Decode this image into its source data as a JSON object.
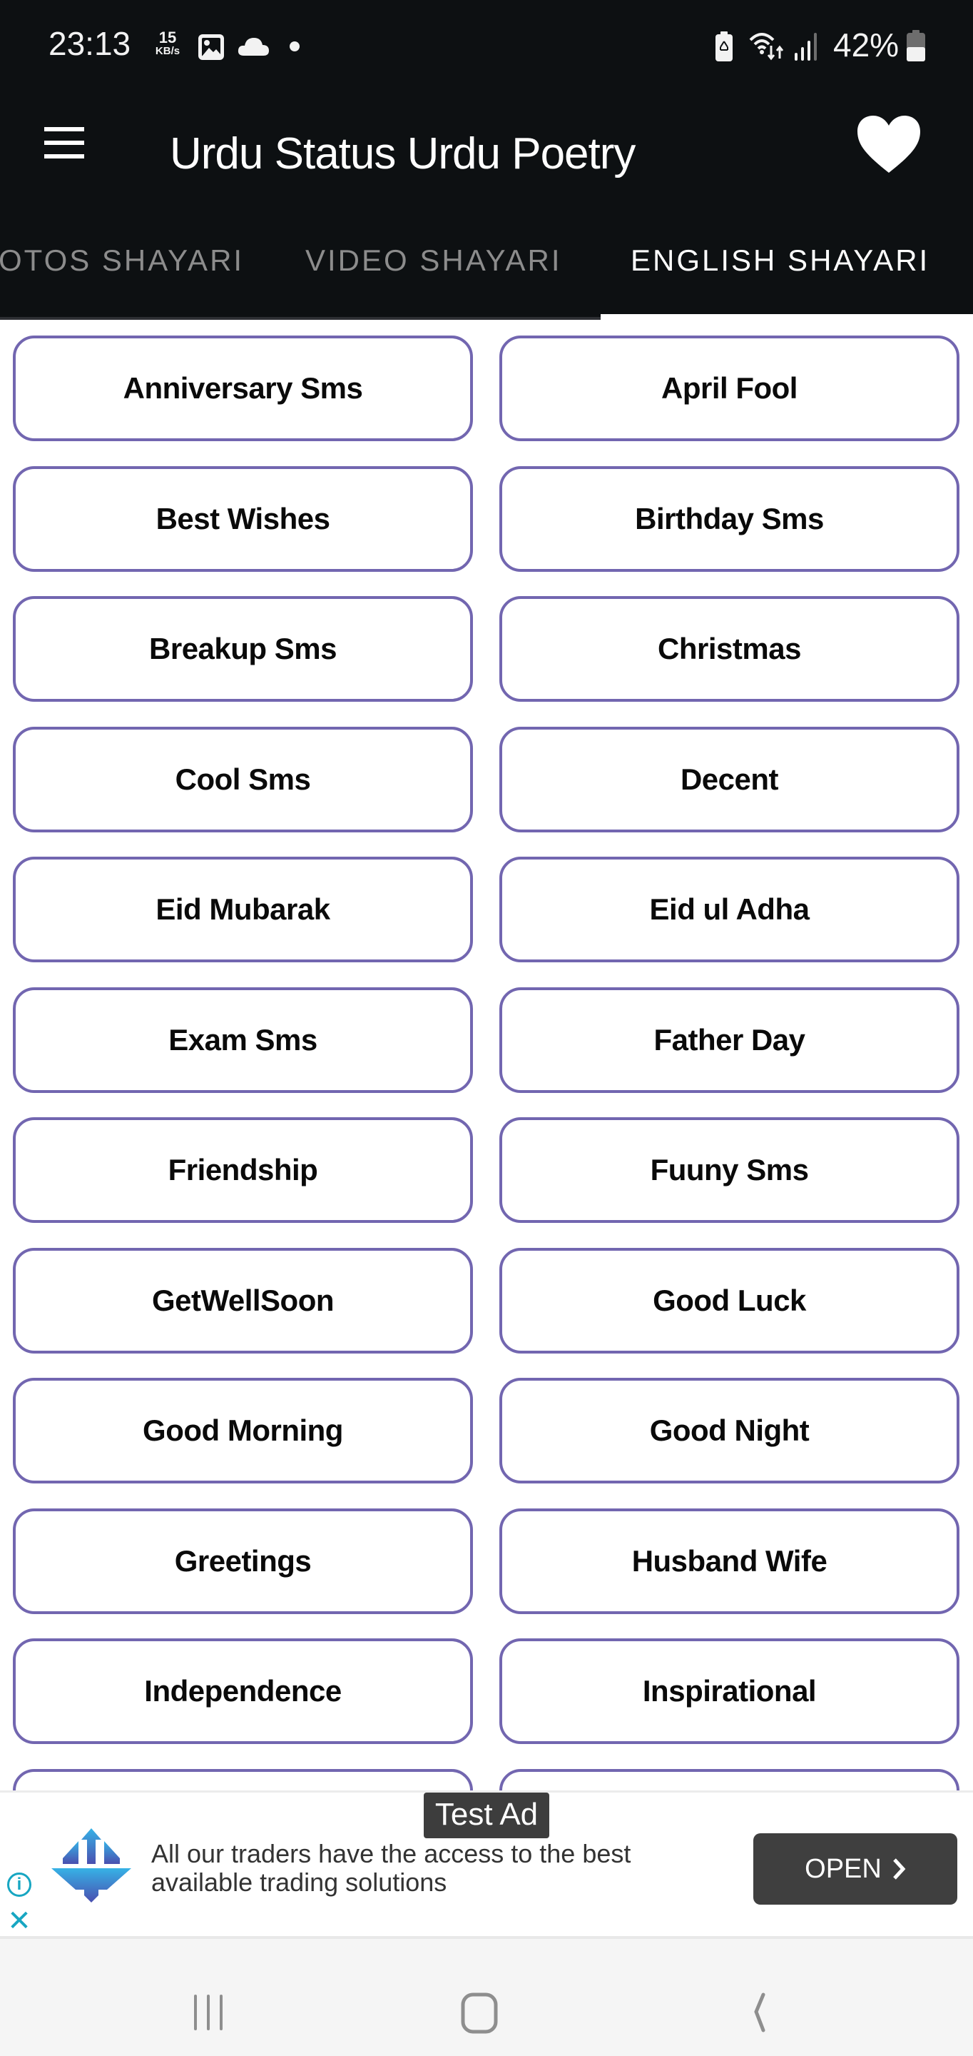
{
  "status_bar": {
    "time": "23:13",
    "net_speed_value": "15",
    "net_speed_unit": "KB/s",
    "battery_percent": "42%",
    "icons": [
      "gallery-icon",
      "cloud-icon",
      "notification-dot-icon",
      "battery-saver-icon",
      "wifi-icon",
      "signal-icon",
      "battery-icon"
    ]
  },
  "app_bar": {
    "title": "Urdu Status Urdu Poetry",
    "menu_icon": "hamburger-menu-icon",
    "favorite_icon": "heart-icon"
  },
  "tabs": [
    {
      "label": "PHOTOS SHAYARI",
      "visible_text": "OTOS SHAYARI",
      "active": false
    },
    {
      "label": "VIDEO SHAYARI",
      "active": false
    },
    {
      "label": "ENGLISH SHAYARI",
      "active": true
    }
  ],
  "categories": [
    "Anniversary Sms",
    "April Fool",
    "Best Wishes",
    "Birthday Sms",
    "Breakup Sms",
    "Christmas",
    "Cool Sms",
    "Decent",
    "Eid Mubarak",
    "Eid ul Adha",
    "Exam Sms",
    "Father Day",
    "Friendship",
    "Fuuny Sms",
    "GetWellSoon",
    "Good Luck",
    "Good Morning",
    "Good Night",
    "Greetings",
    "Husband Wife",
    "Independence",
    "Inspirational",
    "",
    ""
  ],
  "ad": {
    "badge": "Test Ad",
    "text": "All our traders have the access to the best available trading solutions",
    "cta": "OPEN",
    "cta_icon": "chevron-right-icon",
    "info_icon": "info-icon",
    "close_icon": "close-icon"
  },
  "nav_bar": {
    "recents": "recents-icon",
    "home": "home-icon",
    "back": "back-icon"
  },
  "colors": {
    "bar_bg": "#0d1012",
    "button_border": "#7266b0",
    "ad_accent": "#17a6c2",
    "ad_button": "#3f3f3f"
  }
}
